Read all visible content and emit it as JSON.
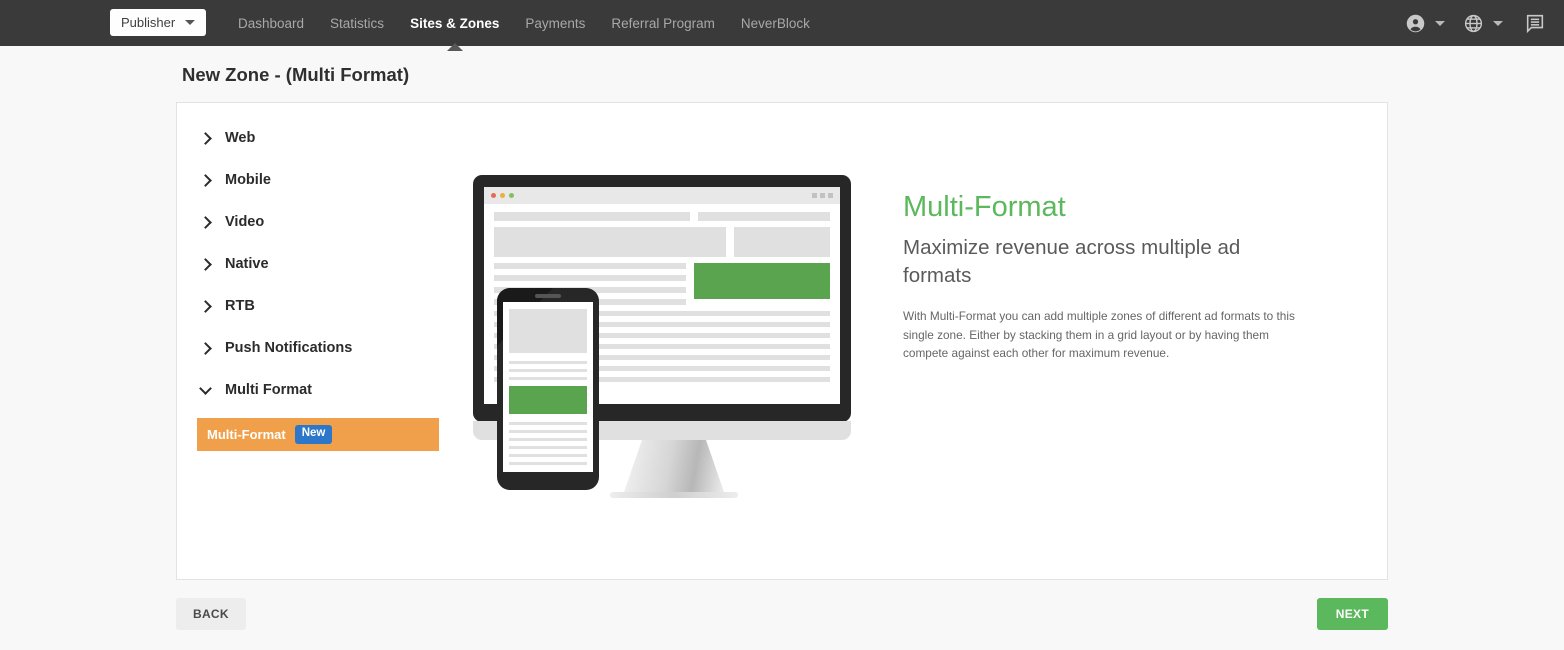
{
  "topbar": {
    "account_button": {
      "label": "Publisher",
      "caret": "chevron-down-icon"
    },
    "nav_items": [
      {
        "label": "Dashboard",
        "active": false
      },
      {
        "label": "Statistics",
        "active": false
      },
      {
        "label": "Sites & Zones",
        "active": true
      },
      {
        "label": "Payments",
        "active": false
      },
      {
        "label": "Referral Program",
        "active": false
      },
      {
        "label": "NeverBlock",
        "active": false
      }
    ],
    "right_icons": [
      {
        "name": "account-icon"
      },
      {
        "name": "chevron-down-icon"
      },
      {
        "name": "globe-icon"
      },
      {
        "name": "chevron-down-icon"
      },
      {
        "name": "messages-icon"
      }
    ],
    "background": "#3a3a3a"
  },
  "page": {
    "title": "New Zone - (Multi Format)"
  },
  "accordion": {
    "items": [
      {
        "label": "Web",
        "expanded": false
      },
      {
        "label": "Mobile",
        "expanded": false
      },
      {
        "label": "Video",
        "expanded": false
      },
      {
        "label": "Native",
        "expanded": false
      },
      {
        "label": "RTB",
        "expanded": false
      },
      {
        "label": "Push Notifications",
        "expanded": false
      },
      {
        "label": "Multi Format",
        "expanded": true
      }
    ],
    "selected_child": {
      "label": "Multi-Format",
      "badge": "New",
      "background": "#f0a04b",
      "badge_color": "#2c77c9"
    }
  },
  "info": {
    "heading": "Multi-Format",
    "heading_color": "#5cb85c",
    "subheading": "Maximize revenue across multiple ad formats",
    "description": "With Multi-Format you can add multiple zones of different ad formats to this single zone. Either by stacking them in a grid layout or by having them compete against each other for maximum revenue."
  },
  "illustration": {
    "name": "multi-format-devices-illustration",
    "ad_color": "#5aa450",
    "devices": [
      "desktop-monitor",
      "mobile-phone"
    ],
    "window_dots": [
      "red",
      "yellow",
      "green"
    ]
  },
  "footer": {
    "back_label": "BACK",
    "next_label": "NEXT",
    "next_color": "#5cb85c"
  }
}
